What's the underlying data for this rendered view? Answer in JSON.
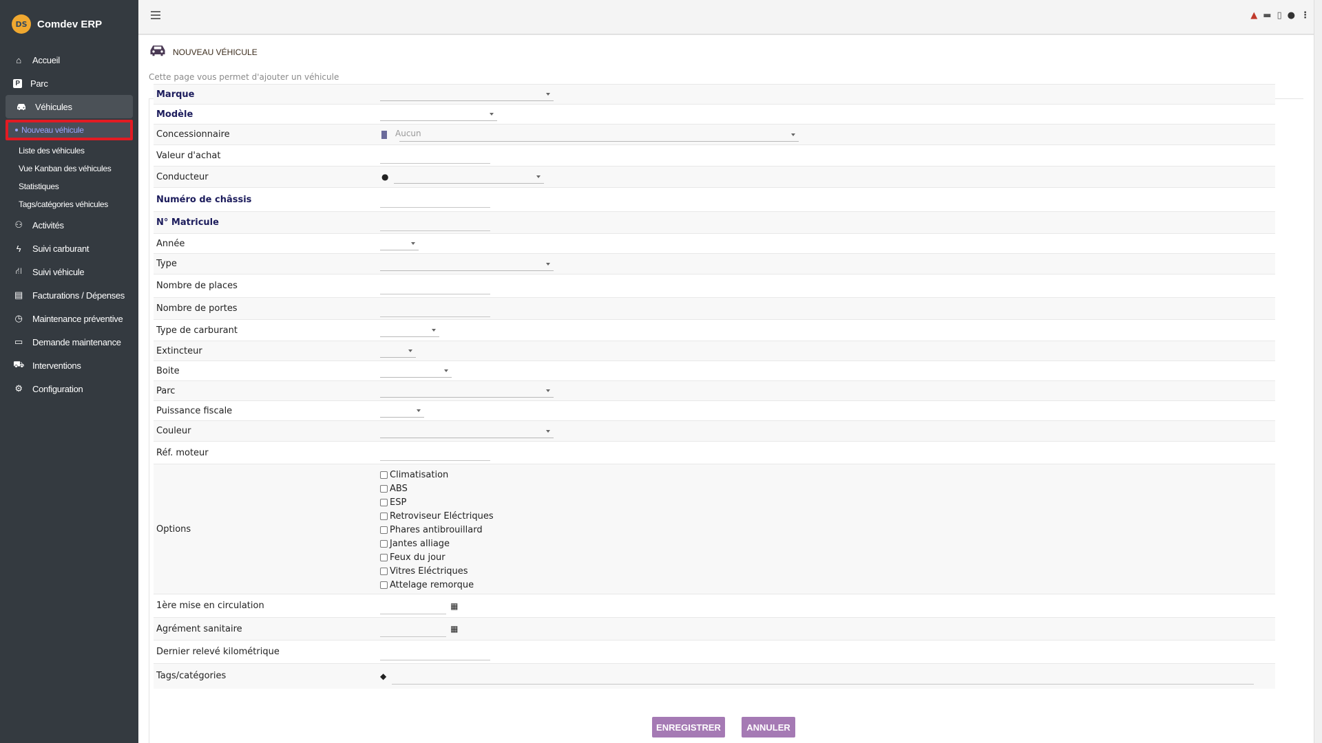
{
  "app": {
    "name": "Comdev ERP",
    "logo_text": "DS"
  },
  "sidebar": {
    "items": [
      {
        "label": "Accueil",
        "icon": "home-icon",
        "glyph": "⌂"
      },
      {
        "label": "Parc",
        "icon": "parking-icon",
        "glyph": "P"
      },
      {
        "label": "Véhicules",
        "icon": "car-icon",
        "glyph": "🚘"
      }
    ],
    "subitems": [
      {
        "label": "Nouveau véhicule",
        "active": true
      },
      {
        "label": "Liste des véhicules"
      },
      {
        "label": "Vue Kanban des véhicules"
      },
      {
        "label": "Statistiques"
      },
      {
        "label": "Tags/catégories véhicules"
      }
    ],
    "items2": [
      {
        "label": "Activités",
        "icon": "activities-icon",
        "glyph": "⚇"
      },
      {
        "label": "Suivi carburant",
        "icon": "bolt-icon",
        "glyph": "ϟ"
      },
      {
        "label": "Suivi véhicule",
        "icon": "road-icon",
        "glyph": "⛙"
      },
      {
        "label": "Facturations / Dépenses",
        "icon": "invoice-icon",
        "glyph": "▤"
      },
      {
        "label": "Maintenance préventive",
        "icon": "clock-icon",
        "glyph": "◷"
      },
      {
        "label": "Demande maintenance",
        "icon": "keyboard-icon",
        "glyph": "▭"
      },
      {
        "label": "Interventions",
        "icon": "truck-icon",
        "glyph": "⛟"
      },
      {
        "label": "Configuration",
        "icon": "gears-icon",
        "glyph": "⚙"
      }
    ]
  },
  "page": {
    "title": "NOUVEAU VÉHICULE",
    "subtitle": "Cette page vous permet d'ajouter un véhicule"
  },
  "form": {
    "marque": "Marque",
    "modele": "Modèle",
    "concessionnaire": "Concessionnaire",
    "concessionnaire_placeholder": "Aucun",
    "valeur": "Valeur d'achat",
    "conducteur": "Conducteur",
    "chassis": "Numéro de châssis",
    "matricule": "N° Matricule",
    "annee": "Année",
    "type": "Type",
    "places": "Nombre de places",
    "portes": "Nombre de portes",
    "carburant": "Type de carburant",
    "extincteur": "Extincteur",
    "boite": "Boite",
    "parc": "Parc",
    "puissance": "Puissance fiscale",
    "couleur": "Couleur",
    "moteur": "Réf. moteur",
    "options": "Options",
    "option_list": [
      "Climatisation",
      "ABS",
      "ESP",
      "Retroviseur Eléctriques",
      "Phares antibrouillard",
      "Jantes alliage",
      "Feux du jour",
      "Vitres Eléctriques",
      "Attelage remorque"
    ],
    "mise_circ": "1ère mise en circulation",
    "agrement": "Agrément sanitaire",
    "km": "Dernier relevé kilométrique",
    "tags": "Tags/catégories"
  },
  "buttons": {
    "save": "ENREGISTRER",
    "cancel": "ANNULER"
  }
}
